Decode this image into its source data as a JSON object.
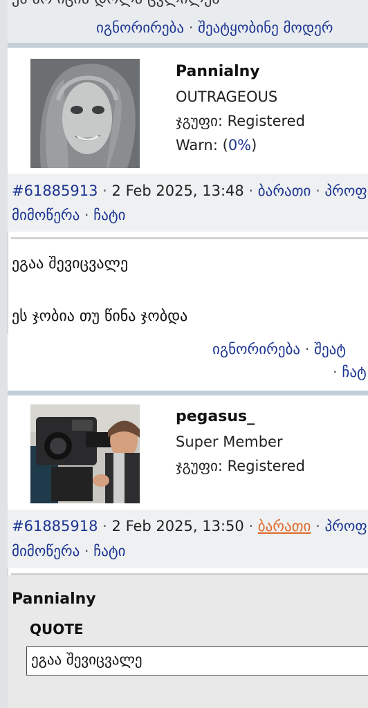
{
  "top": {
    "cut_text": "ეს არ იცის დოლა ცვლილებ",
    "actions": [
      "იგნორირება",
      "შეატყობინე მოდერ"
    ]
  },
  "posts": [
    {
      "username": "Pannialny",
      "rank": "OUTRAGEOUS",
      "group": "ჯგუფი: Registered",
      "warn_prefix": "Warn: (",
      "warn_value": "0%",
      "warn_suffix": ")",
      "id": "#61885913",
      "datetime": "2 Feb 2025, 13:48",
      "links_line1": [
        "ბარათი",
        "პროფ"
      ],
      "links_line2": [
        "მიმოწერა",
        "ჩატი"
      ],
      "body": [
        "ეგაა შევიცვალე",
        "ეს ჯობია თუ წინა ჯობდა"
      ],
      "actions_line1": [
        "იგნორირება",
        "შეატ"
      ],
      "actions_line2": [
        "ჩატ"
      ]
    },
    {
      "username": "pegasus_",
      "rank": "Super Member",
      "group": "ჯგუფი: Registered",
      "id": "#61885918",
      "datetime": "2 Feb 2025, 13:50",
      "links_line1": [
        "ბარათი",
        "პროფ"
      ],
      "links_line2": [
        "მიმოწერა",
        "ჩატი"
      ],
      "quote_author": "Pannialny",
      "quote_label": "QUOTE",
      "quote_text": "ეგაა შევიცვალე"
    }
  ],
  "colors": {
    "link": "#1c3591",
    "link_active": "#e06a2a",
    "separator": "#c3ced8",
    "meta_bg": "#eef0f2"
  }
}
